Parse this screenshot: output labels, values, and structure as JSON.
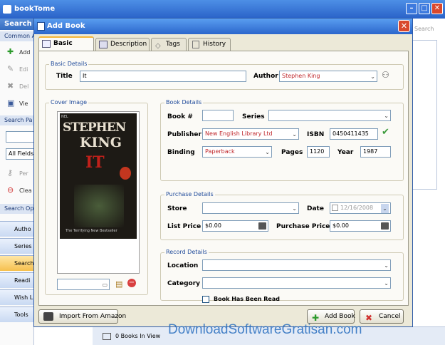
{
  "app": {
    "title": "bookTome",
    "search_hint": "Search"
  },
  "sidebar": {
    "header": "Search",
    "common_actions": "Common A",
    "actions": [
      {
        "label": "Add",
        "icon": "plus-icon"
      },
      {
        "label": "Edi",
        "icon": "pencil-icon"
      },
      {
        "label": "Del",
        "icon": "delete-icon"
      },
      {
        "label": "Vie",
        "icon": "view-icon"
      }
    ],
    "search_panel": "Search Pa",
    "fields_value": "All Fields",
    "search_items": [
      {
        "label": "Per",
        "icon": "key-icon"
      },
      {
        "label": "Clea",
        "icon": "clear-icon"
      }
    ],
    "search_options": "Search Op",
    "nav": [
      "Autho",
      "Series",
      "Search",
      "Readi",
      "Wish L",
      "Tools"
    ]
  },
  "dialog": {
    "title": "Add Book",
    "tabs": [
      "Basic Details",
      "Description",
      "Tags",
      "History"
    ],
    "basic_group": "Basic Details",
    "title_label": "Title",
    "title_value": "It",
    "author_label": "Author",
    "author_value": "Stephen King",
    "cover_group": "Cover Image",
    "cover": {
      "line1": "STEPHEN",
      "line2": "KING",
      "line3": "IT",
      "tagline": "The Terrifying New Bestseller",
      "publisher": "NEL"
    },
    "book_group": "Book Details",
    "book_no_label": "Book #",
    "book_no_value": "",
    "series_label": "Series",
    "series_value": "",
    "publisher_label": "Publisher",
    "publisher_value": "New English Library Ltd",
    "isbn_label": "ISBN",
    "isbn_value": "0450411435",
    "binding_label": "Binding",
    "binding_value": "Paperback",
    "pages_label": "Pages",
    "pages_value": "1120",
    "year_label": "Year",
    "year_value": "1987",
    "purchase_group": "Purchase Details",
    "store_label": "Store",
    "store_value": "",
    "date_label": "Date",
    "date_value": "12/16/2008",
    "list_price_label": "List Price",
    "list_price_value": "$0.00",
    "purchase_price_label": "Purchase Price",
    "purchase_price_value": "$0.00",
    "record_group": "Record Details",
    "location_label": "Location",
    "location_value": "",
    "category_label": "Category",
    "category_value": "",
    "read_label": "Book Has Been Read",
    "import_button": "Import From Amazon",
    "add_button": "Add Book",
    "cancel_button": "Cancel"
  },
  "status": {
    "books_in_view": "0 Books In View"
  },
  "watermark": "DownloadSoftwareGratisan.com"
}
